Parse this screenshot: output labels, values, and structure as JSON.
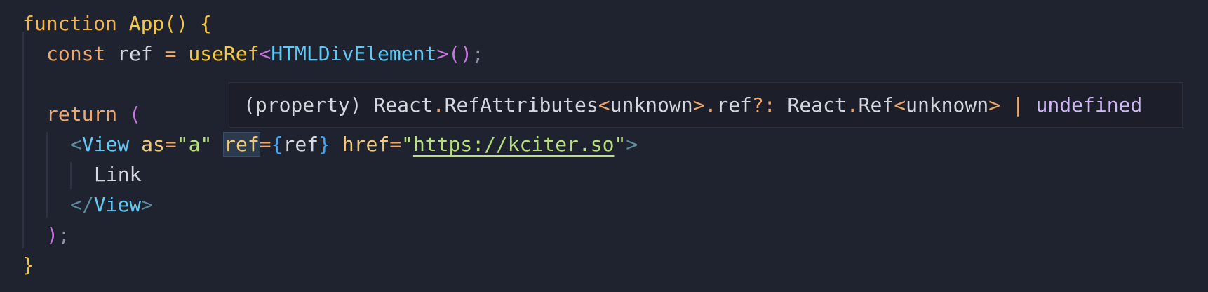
{
  "code": {
    "line1": {
      "kw_function": "function",
      "fn_name": "App",
      "parens": "()",
      "open_brace": "{"
    },
    "line2": {
      "kw_const": "const",
      "var_ref": "ref",
      "eq": "=",
      "call": "useRef",
      "lt": "<",
      "type": "HTMLDivElement",
      "gt": ">",
      "call_parens": "()",
      "semi": ";"
    },
    "line4": {
      "kw_return": "return",
      "open_paren": "("
    },
    "line5": {
      "lt": "<",
      "tag": "View",
      "attr_as": "as",
      "eq1": "=",
      "str_a": "\"a\"",
      "attr_ref": "ref",
      "eq2": "=",
      "brace_open": "{",
      "ref_val": "ref",
      "brace_close": "}",
      "attr_href": "href",
      "eq3": "=",
      "quote_open": "\"",
      "url": "https://kciter.so",
      "quote_close": "\"",
      "gt": ">"
    },
    "line6": {
      "text": "Link"
    },
    "line7": {
      "lt": "</",
      "tag": "View",
      "gt": ">"
    },
    "line8": {
      "close_paren": ")",
      "semi": ";"
    },
    "line9": {
      "close_brace": "}"
    }
  },
  "tooltip": {
    "kind": "(property)",
    "ns1": "React",
    "dot1": ".",
    "type1": "RefAttributes",
    "lt1": "<",
    "generic1": "unknown",
    "gt1": ">",
    "dot2": ".",
    "prop": "ref",
    "optional": "?:",
    "ns2": "React",
    "dot3": ".",
    "type2": "Ref",
    "lt2": "<",
    "generic2": "unknown",
    "gt2": ">",
    "pipe": "|",
    "undef": "undefined"
  }
}
